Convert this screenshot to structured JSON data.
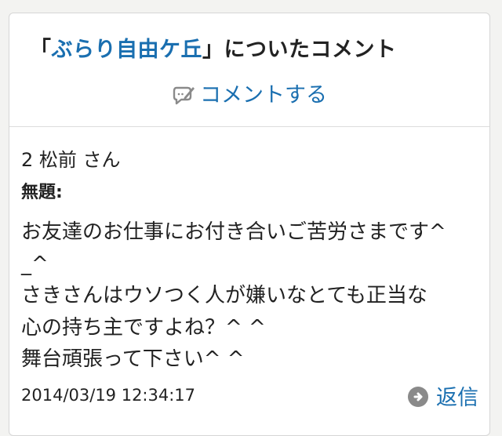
{
  "header": {
    "title_open": "「",
    "title_link": "ぶらり自由ケ丘",
    "title_close": "」についたコメント",
    "comment_action_label": "コメントする"
  },
  "comment": {
    "author": "2 松前 さん",
    "subject": "無題:",
    "message_lines": [
      "お友達のお仕事にお付き合いご苦労さまです^",
      "_^",
      "さきさんはウソつく人が嫌いなとても正当な",
      "心の持ち主ですよね？^ ^",
      "舞台頑張って下さい^ ^"
    ],
    "date": "2014/03/19 12:34:17",
    "reply_label": "返信"
  },
  "colors": {
    "link": "#1a6fb0",
    "text": "#222222",
    "background": "#f3f3f1",
    "icon_gray": "#8a8a8a"
  },
  "icons": {
    "comment_action": "edit-comment-icon",
    "reply": "reply-arrow-icon"
  }
}
